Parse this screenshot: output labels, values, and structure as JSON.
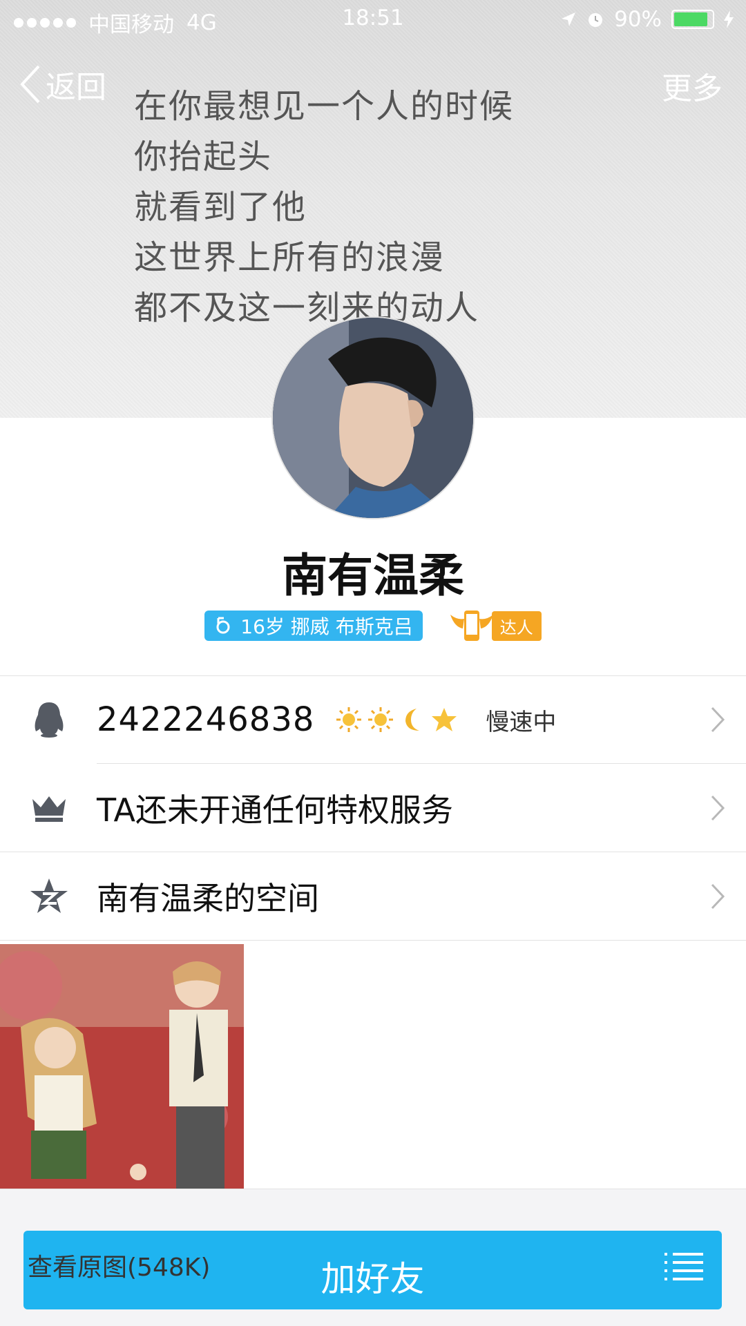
{
  "status_bar": {
    "carrier": "中国移动",
    "network": "4G",
    "time": "18:51",
    "battery": "90%"
  },
  "nav": {
    "back_label": "返回",
    "more_label": "更多"
  },
  "cover_poem": [
    "在你最想见一个人的时候",
    "你抬起头",
    "就看到了他",
    "这世界上所有的浪漫",
    "都不及这一刻来的动人"
  ],
  "profile": {
    "name": "南有温柔",
    "info_tag": "16岁 挪威 布斯克吕",
    "badge_label": "达人"
  },
  "rows": {
    "qq_number": "2422246838",
    "speed_status": "慢速中",
    "privilege": "TA还未开通任何特权服务",
    "space": "南有温柔的空间"
  },
  "bottom": {
    "view_original": "查看原图(548K)",
    "add_friend": "加好友"
  },
  "colors": {
    "accent": "#1fb4f0",
    "tag_blue": "#33b5f0",
    "badge_orange": "#f5a623"
  },
  "icons": [
    "chevron-left-icon",
    "qq-penguin-icon",
    "crown-icon",
    "qzone-star-icon",
    "chevron-right-icon",
    "sun-icon",
    "moon-icon",
    "star-icon",
    "list-menu-icon",
    "location-arrow-icon",
    "alarm-icon",
    "charging-icon",
    "male-icon",
    "phone-angel-icon"
  ]
}
